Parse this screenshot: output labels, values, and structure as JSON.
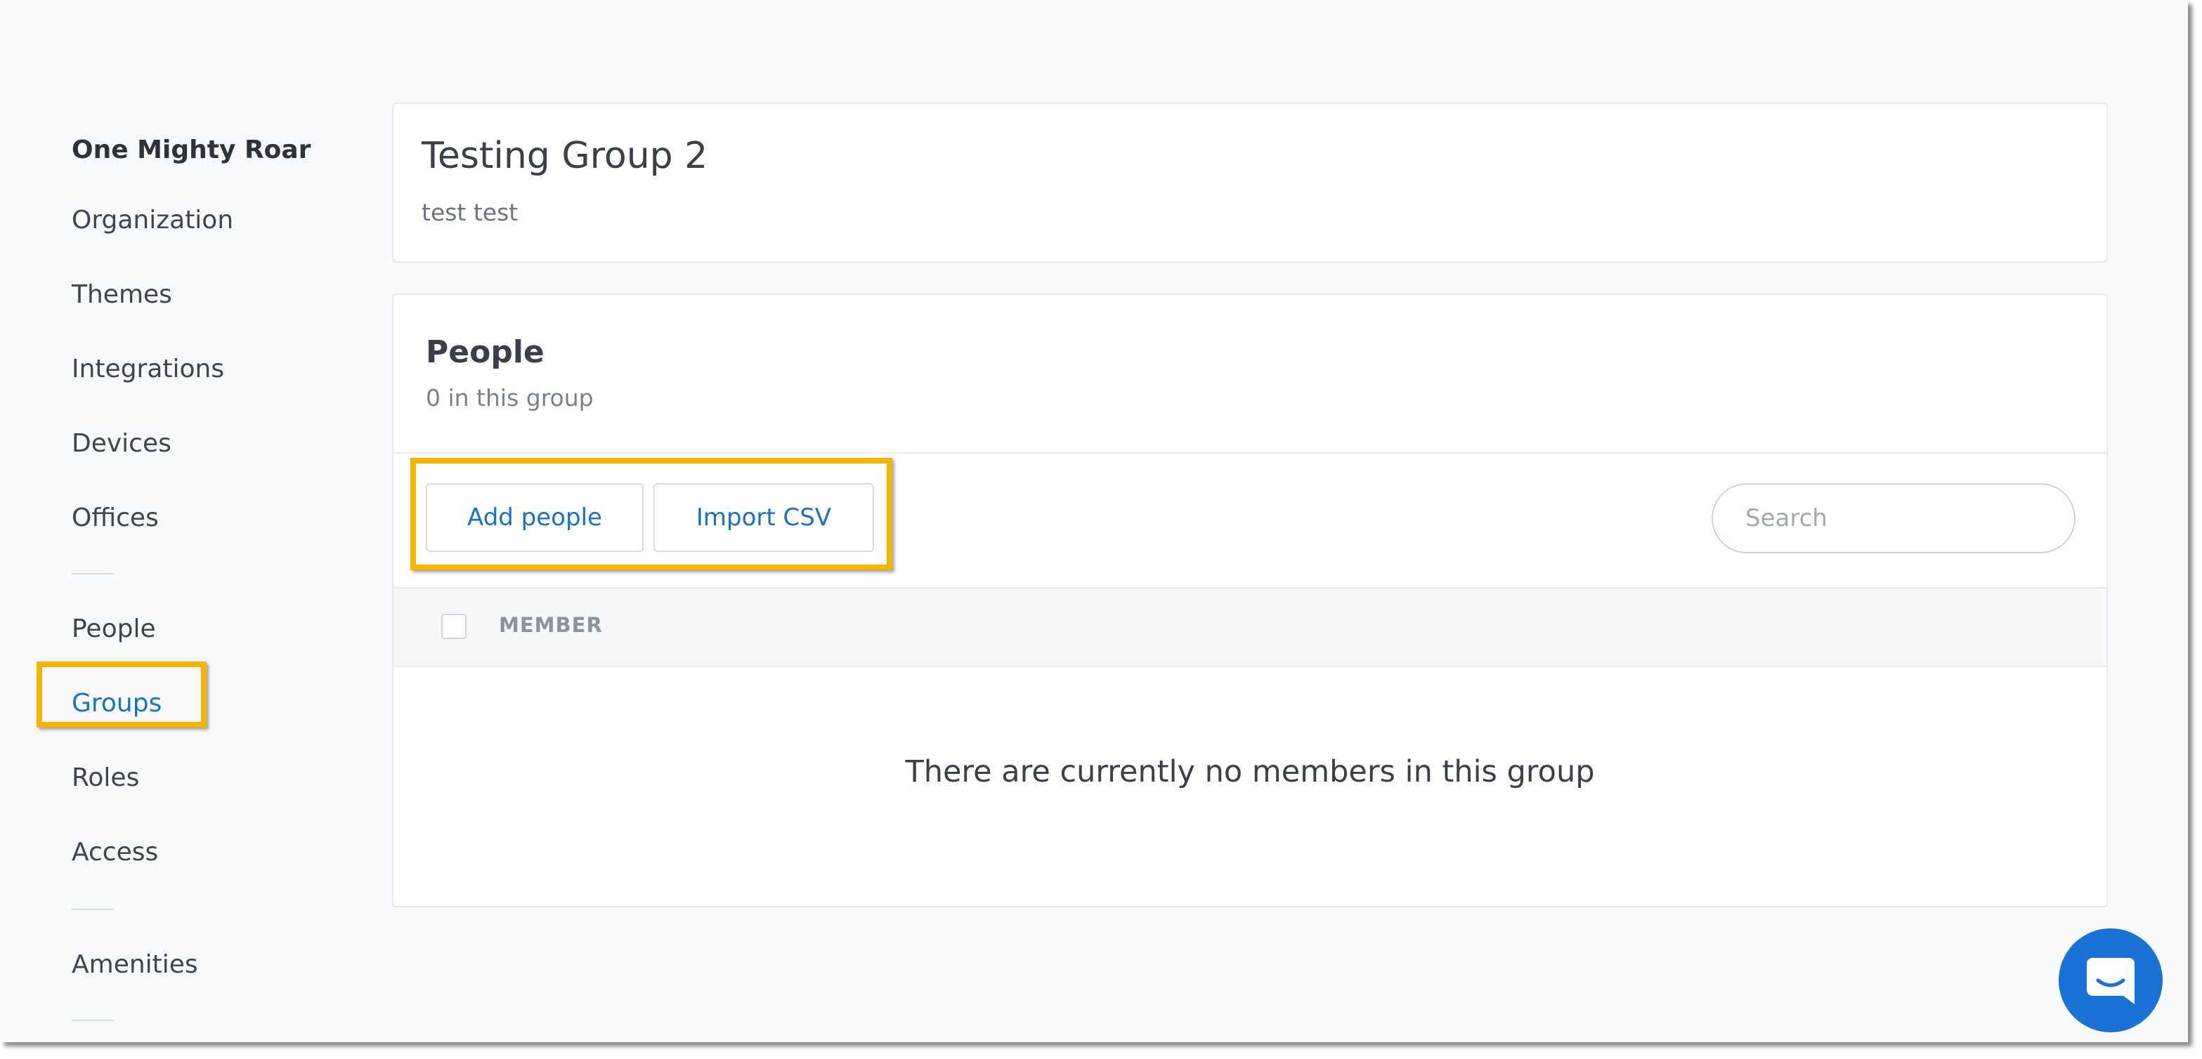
{
  "sidebar": {
    "org_name": "One Mighty Roar",
    "items": [
      {
        "label": "Organization"
      },
      {
        "label": "Themes"
      },
      {
        "label": "Integrations"
      },
      {
        "label": "Devices"
      },
      {
        "label": "Offices"
      },
      {
        "label": "People"
      },
      {
        "label": "Groups",
        "active": true
      },
      {
        "label": "Roles"
      },
      {
        "label": "Access"
      },
      {
        "label": "Amenities"
      }
    ]
  },
  "group": {
    "title": "Testing Group 2",
    "description": "test test"
  },
  "people_section": {
    "title": "People",
    "count_text": "0 in this group",
    "add_people_label": "Add people",
    "import_csv_label": "Import CSV",
    "search_placeholder": "Search",
    "column_member": "MEMBER",
    "empty_message": "There are currently no members in this group"
  },
  "icons": {
    "chat": "chat-bubble-icon"
  },
  "colors": {
    "accent": "#1771c4",
    "highlight": "#f5b400",
    "chat_button": "#1a72d6"
  }
}
